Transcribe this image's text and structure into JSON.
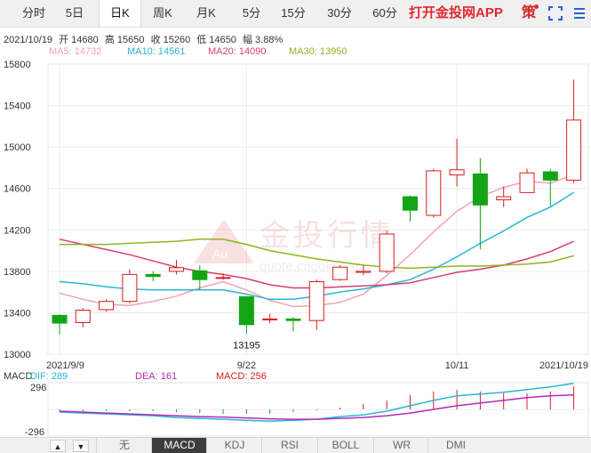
{
  "tabs": [
    {
      "label": "分时",
      "active": false
    },
    {
      "label": "5日",
      "active": false
    },
    {
      "label": "日K",
      "active": true
    },
    {
      "label": "周K",
      "active": false
    },
    {
      "label": "月K",
      "active": false
    },
    {
      "label": "5分",
      "active": false
    },
    {
      "label": "15分",
      "active": false
    },
    {
      "label": "30分",
      "active": false
    },
    {
      "label": "60分",
      "active": false
    }
  ],
  "brand": "打开金投网APP",
  "ce_label": "策",
  "info": {
    "date": "2021/10/19",
    "open": "开 14680",
    "high": "高 15650",
    "close": "收 15260",
    "low": "低 14650",
    "change": "幅 3.88%"
  },
  "ma": [
    {
      "label": "MA5: 14732",
      "color": "#f3a3b8"
    },
    {
      "label": "MA10: 14561",
      "color": "#29b6d6"
    },
    {
      "label": "MA20: 14090",
      "color": "#d63f6e"
    },
    {
      "label": "MA30: 13950",
      "color": "#8fb41e"
    }
  ],
  "watermark": "金投行情",
  "watermark_sub": "quote.cngold.org",
  "watermark_logo": "Au",
  "macd_info": {
    "name": "MACD",
    "dif": "DIF: 289",
    "dea": "DEA: 161",
    "macd": "MACD: 256"
  },
  "macd_axis": [
    "296",
    "-296"
  ],
  "bottom_arrows": [
    "▲",
    "▼"
  ],
  "indicators": [
    {
      "label": "无",
      "active": false
    },
    {
      "label": "MACD",
      "active": true
    },
    {
      "label": "KDJ",
      "active": false
    },
    {
      "label": "RSI",
      "active": false
    },
    {
      "label": "BOLL",
      "active": false
    },
    {
      "label": "WR",
      "active": false
    },
    {
      "label": "DMI",
      "active": false
    }
  ],
  "colors": {
    "up": "#d91d1d",
    "down": "#13a516",
    "dif": "#29b6d6",
    "dea": "#b52ab8"
  },
  "chart_data": {
    "type": "candlestick",
    "ylim": [
      13000,
      15800
    ],
    "yticks": [
      15800,
      15400,
      15000,
      14600,
      14200,
      13800,
      13400,
      13000
    ],
    "ytick_labels": [
      "15800",
      "15400",
      "15000",
      "14600",
      "14200",
      "13800",
      "13400",
      "13000"
    ],
    "xtick_labels": [
      {
        "label": "2021/9/9",
        "index": 0
      },
      {
        "label": "9/22",
        "index": 8
      },
      {
        "label": "10/11",
        "index": 17
      },
      {
        "label": "2021/10/19",
        "index": 23
      }
    ],
    "annotations": [
      {
        "text": "15650",
        "index": 24,
        "value": 15650
      },
      {
        "text": "13195",
        "index": 8,
        "value": 13195
      }
    ],
    "candles": [
      {
        "o": 13375,
        "h": 13385,
        "l": 13190,
        "c": 13300
      },
      {
        "o": 13305,
        "h": 13445,
        "l": 13260,
        "c": 13425
      },
      {
        "o": 13430,
        "h": 13530,
        "l": 13410,
        "c": 13510
      },
      {
        "o": 13510,
        "h": 13820,
        "l": 13490,
        "c": 13770
      },
      {
        "o": 13770,
        "h": 13800,
        "l": 13705,
        "c": 13750
      },
      {
        "o": 13800,
        "h": 13910,
        "l": 13770,
        "c": 13835
      },
      {
        "o": 13805,
        "h": 13860,
        "l": 13620,
        "c": 13720
      },
      {
        "o": 13740,
        "h": 13780,
        "l": 13720,
        "c": 13740
      },
      {
        "o": 13555,
        "h": 13560,
        "l": 13195,
        "c": 13285
      },
      {
        "o": 13340,
        "h": 13390,
        "l": 13300,
        "c": 13340
      },
      {
        "o": 13340,
        "h": 13355,
        "l": 13220,
        "c": 13325
      },
      {
        "o": 13325,
        "h": 13720,
        "l": 13235,
        "c": 13700
      },
      {
        "o": 13720,
        "h": 13860,
        "l": 13710,
        "c": 13840
      },
      {
        "o": 13790,
        "h": 13855,
        "l": 13765,
        "c": 13800
      },
      {
        "o": 13800,
        "h": 14190,
        "l": 13780,
        "c": 14160
      },
      {
        "o": 14520,
        "h": 14530,
        "l": 14280,
        "c": 14390
      },
      {
        "o": 14340,
        "h": 14790,
        "l": 14320,
        "c": 14770
      },
      {
        "o": 14730,
        "h": 15080,
        "l": 14620,
        "c": 14780
      },
      {
        "o": 14740,
        "h": 14890,
        "l": 14010,
        "c": 14440
      },
      {
        "o": 14490,
        "h": 14620,
        "l": 14420,
        "c": 14520
      },
      {
        "o": 14560,
        "h": 14790,
        "l": 14560,
        "c": 14750
      },
      {
        "o": 14760,
        "h": 14790,
        "l": 14430,
        "c": 14680
      },
      {
        "o": 14680,
        "h": 15650,
        "l": 14650,
        "c": 15260
      }
    ],
    "series": [
      {
        "name": "MA5",
        "color": "#f3a3b8",
        "values": [
          13590,
          13530,
          13480,
          13470,
          13510,
          13560,
          13640,
          13700,
          13620,
          13520,
          13460,
          13470,
          13500,
          13580,
          13760,
          13960,
          14180,
          14380,
          14520,
          14610,
          14670,
          14650,
          14732
        ]
      },
      {
        "name": "MA10",
        "color": "#29b6d6",
        "values": [
          13700,
          13680,
          13650,
          13630,
          13620,
          13620,
          13620,
          13620,
          13580,
          13530,
          13530,
          13560,
          13600,
          13630,
          13670,
          13720,
          13820,
          13940,
          14070,
          14190,
          14320,
          14420,
          14561
        ]
      },
      {
        "name": "MA20",
        "color": "#d63f6e",
        "values": [
          14110,
          14060,
          14010,
          13960,
          13900,
          13840,
          13800,
          13770,
          13730,
          13670,
          13640,
          13640,
          13650,
          13660,
          13670,
          13690,
          13740,
          13790,
          13820,
          13860,
          13920,
          13990,
          14090
        ]
      },
      {
        "name": "MA30",
        "color": "#8fb41e",
        "values": [
          14060,
          14060,
          14060,
          14070,
          14080,
          14090,
          14110,
          14110,
          14060,
          14000,
          13960,
          13920,
          13890,
          13860,
          13840,
          13830,
          13840,
          13850,
          13850,
          13860,
          13870,
          13890,
          13950
        ]
      }
    ],
    "macd": {
      "ylim": [
        -296,
        296
      ],
      "dif": [
        -30,
        -40,
        -50,
        -60,
        -70,
        -90,
        -100,
        -110,
        -120,
        -130,
        -120,
        -110,
        -80,
        -60,
        -20,
        40,
        100,
        150,
        170,
        190,
        220,
        250,
        289
      ],
      "dea": [
        -20,
        -30,
        -40,
        -50,
        -60,
        -70,
        -80,
        -85,
        -95,
        -105,
        -110,
        -110,
        -100,
        -90,
        -70,
        -40,
        0,
        40,
        70,
        100,
        130,
        150,
        161
      ],
      "hist": [
        -20,
        -20,
        -20,
        -20,
        -20,
        -30,
        -40,
        -50,
        -50,
        -50,
        -30,
        -10,
        20,
        60,
        100,
        160,
        200,
        220,
        200,
        180,
        180,
        200,
        256
      ]
    }
  }
}
